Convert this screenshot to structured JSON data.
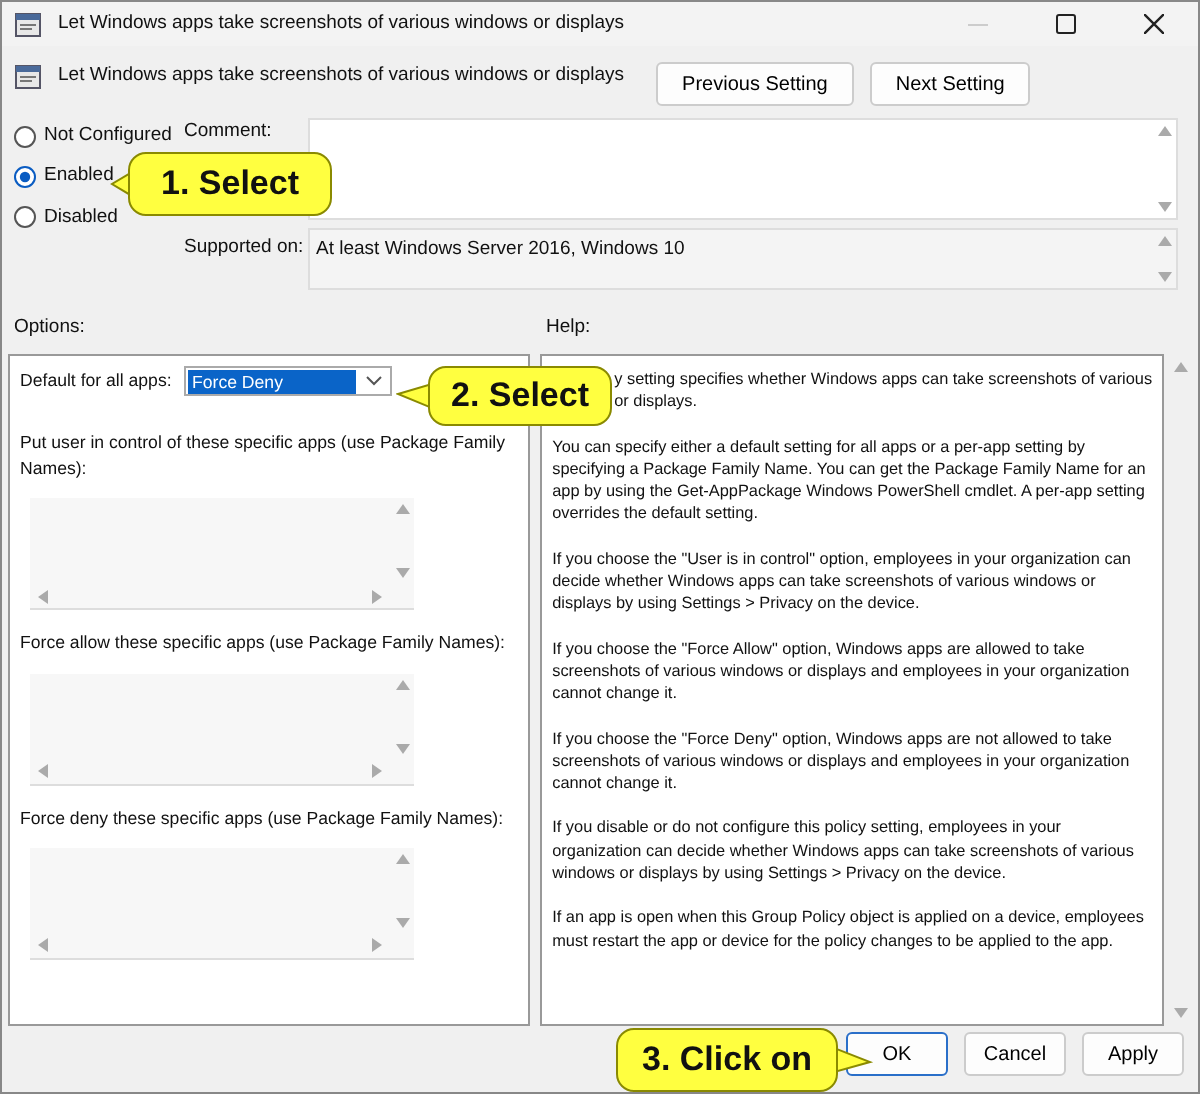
{
  "window": {
    "title": "Let Windows apps take screenshots of various windows or displays"
  },
  "header": {
    "title": "Let Windows apps take screenshots of various windows or displays",
    "buttons": [
      "Previous Setting",
      "Next Setting"
    ]
  },
  "state_options": [
    {
      "label": "Not Configured",
      "selected": false
    },
    {
      "label": "Enabled",
      "selected": true
    },
    {
      "label": "Disabled",
      "selected": false
    }
  ],
  "comment": {
    "label": "Comment:"
  },
  "supported_on": {
    "label": "Supported on:",
    "value": "At least Windows Server 2016, Windows 10"
  },
  "options": {
    "label": "Options:",
    "default_setting": {
      "label": "Default for all apps:",
      "value": "Force Deny"
    },
    "lists": [
      {
        "label": "Put user in control of these specific apps (use Package Family Names):"
      },
      {
        "label": "Force allow these specific apps (use Package Family Names):"
      },
      {
        "label": "Force deny these specific apps (use Package Family Names):"
      }
    ]
  },
  "help": {
    "label": "Help:",
    "paragraphs": [
      {
        "lines": [
          "y setting specifies whether Windows apps can take screenshots of various",
          "or displays."
        ]
      },
      {
        "text": "You can specify either a default setting for all apps or a per-app setting by specifying a Package Family Name. You can get the Package Family Name for an app by using the Get-AppPackage Windows PowerShell cmdlet. A per-app setting overrides the default setting."
      },
      {
        "text": "If you choose the \"User is in control\" option, employees in your organization can decide whether Windows apps can take screenshots of various windows or displays by using Settings > Privacy on the device."
      },
      {
        "text": "If you choose the \"Force Allow\" option, Windows apps are allowed to take screenshots of various windows or displays and employees in your organization cannot change it."
      },
      {
        "text": "If you choose the \"Force Deny\" option, Windows apps are not allowed to take screenshots of various windows or displays and employees in your organization cannot change it."
      },
      {
        "text": "If you disable or do not configure this policy setting, employees in your organization can decide whether Windows apps can take screenshots of various windows or displays by using Settings > Privacy on the device."
      },
      {
        "text": "If an app is open when this Group Policy object is applied on a device, employees must restart the app or device for the policy changes to be applied to the app."
      }
    ]
  },
  "buttons": [
    {
      "label": "OK",
      "default": true
    },
    {
      "label": "Cancel",
      "default": false
    },
    {
      "label": "Apply",
      "default": false
    }
  ],
  "callouts": [
    {
      "text": "1. Select"
    },
    {
      "text": "2. Select"
    },
    {
      "text": "3. Click on"
    }
  ]
}
